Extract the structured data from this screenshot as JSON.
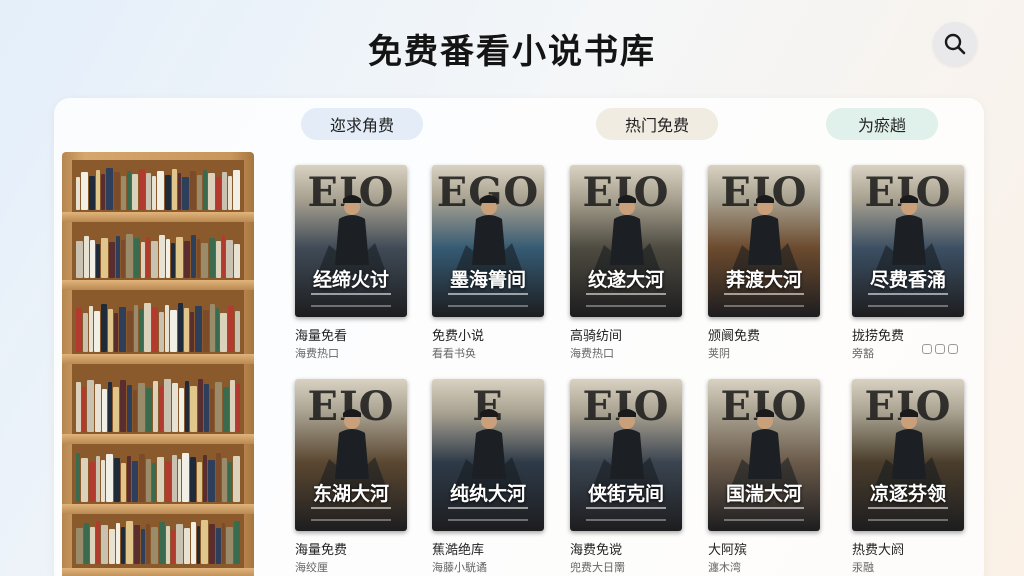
{
  "header": {
    "title": "免费番看小说书库"
  },
  "tabs": [
    {
      "label": "迩求角费"
    },
    {
      "label": "热门免费"
    },
    {
      "label": "为瘀趟"
    }
  ],
  "books": [
    {
      "letters": "EIO",
      "cover_title": "经缔火讨",
      "title": "海量免看",
      "subtitle": "海费热口",
      "tone": "#3f4a56"
    },
    {
      "letters": "EGO",
      "cover_title": "墨海箐间",
      "title": "免费小说",
      "subtitle": "看看书奂",
      "tone": "#355a73"
    },
    {
      "letters": "EIO",
      "cover_title": "纹遂大河",
      "title": "高骑纺间",
      "subtitle": "海费热口",
      "tone": "#4d4a40"
    },
    {
      "letters": "EIO",
      "cover_title": "莽渡大河",
      "title": "颁阛免费",
      "subtitle": "荚阴",
      "tone": "#6b4a2e"
    },
    {
      "letters": "EIO",
      "cover_title": "尽费香涌",
      "title": "拢捞免费",
      "subtitle": "旁豁",
      "tone": "#3c4f63"
    },
    {
      "letters": "EIO",
      "cover_title": "东湖大河",
      "title": "海量免费",
      "subtitle": "海绞厘",
      "tone": "#5a4731"
    },
    {
      "letters": "E",
      "cover_title": "纯纨大河",
      "title": "蕉澔绝库",
      "subtitle": "海藤小駫谲",
      "tone": "#2e3a48"
    },
    {
      "letters": "EIO",
      "cover_title": "侠街克间",
      "title": "海费免谠",
      "subtitle": "兜费大日罱",
      "tone": "#3a4450"
    },
    {
      "letters": "EIO",
      "cover_title": "国湍大河",
      "title": "大阿殡",
      "subtitle": "瀍木湾",
      "tone": "#6a5a4a"
    },
    {
      "letters": "EIO",
      "cover_title": "凉逐芬领",
      "title": "热费大阏",
      "subtitle": "汞融",
      "tone": "#4a3d2c"
    }
  ],
  "icons": {
    "search": "search-icon",
    "pager": "page-dots-icon"
  }
}
